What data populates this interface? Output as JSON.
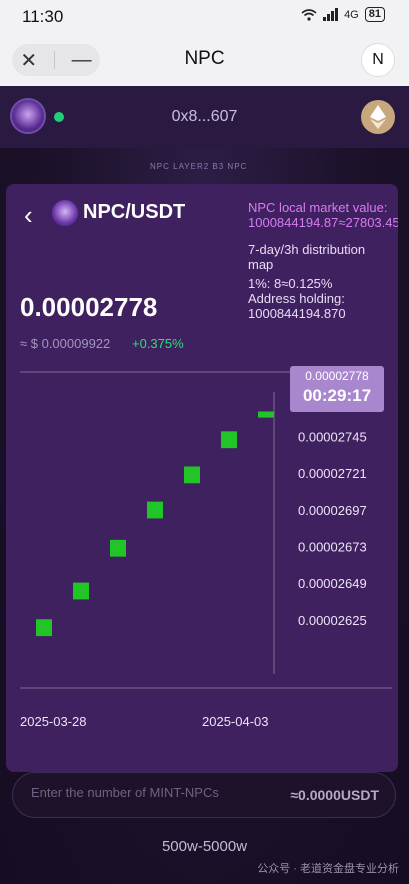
{
  "status_bar": {
    "time": "11:30",
    "network": "4G",
    "battery": "81"
  },
  "title_bar": {
    "close_glyph": "✕",
    "minimize_glyph": "—",
    "title": "NPC",
    "avatar_letter": "N"
  },
  "app_bar": {
    "address": "0x8...607"
  },
  "background": {
    "ring_text": "NPC LAYER2  B3  NPC"
  },
  "card": {
    "pair": "NPC/USDT",
    "market_value_label": "NPC local market value:",
    "market_value": "1000844194.87≈27803.45",
    "distribution_label": "7-day/3h distribution map",
    "distribution_value": "1%:  8≈0.125%",
    "address_holding_label": "Address holding:",
    "address_holding_value": "1000844194.870",
    "price": "0.00002778",
    "usd_price": "≈ $ 0.00009922",
    "change": "+0.375%"
  },
  "tooltip": {
    "price": "0.00002778",
    "time": "00:29:17"
  },
  "chart_data": {
    "type": "candlestick",
    "title": "",
    "xlabel": "",
    "ylabel": "",
    "x_ticks": [
      "2025-03-28",
      "2025-04-03"
    ],
    "y_ticks": [
      2.625e-05,
      2.649e-05,
      2.673e-05,
      2.697e-05,
      2.721e-05,
      2.745e-05,
      2.778e-05
    ],
    "y_tick_labels": [
      "0.00002625",
      "0.00002649",
      "0.00002673",
      "0.00002697",
      "0.00002721",
      "0.00002745",
      "0.00002778"
    ],
    "ylim": [
      2.6e-05,
      2.78e-05
    ],
    "candles": [
      {
        "open": 2.615e-05,
        "close": 2.626e-05
      },
      {
        "open": 2.639e-05,
        "close": 2.65e-05
      },
      {
        "open": 2.667e-05,
        "close": 2.678e-05
      },
      {
        "open": 2.692e-05,
        "close": 2.703e-05
      },
      {
        "open": 2.715e-05,
        "close": 2.726e-05
      },
      {
        "open": 2.738e-05,
        "close": 2.749e-05
      },
      {
        "open": 2.758e-05,
        "close": 2.762e-05
      }
    ],
    "colors": {
      "up": "#21c527",
      "grid": "#7b6a92"
    }
  },
  "input": {
    "placeholder": "Enter the number of MINT-NPCs",
    "approx": "≈0.0000USDT"
  },
  "range_label": "500w-5000w",
  "watermark": "公众号 · 老道资金盘专业分析"
}
